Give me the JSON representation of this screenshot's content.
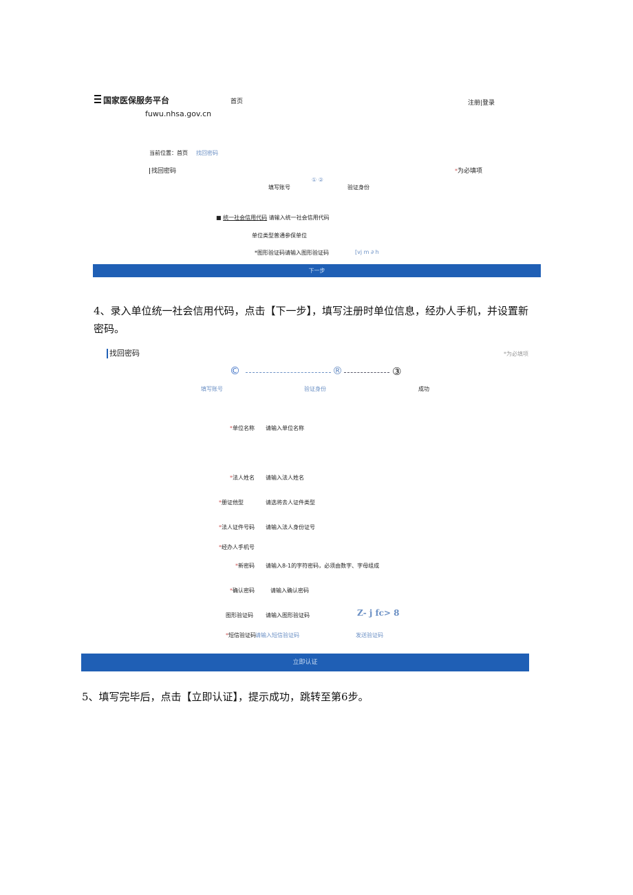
{
  "header": {
    "logo_text": "国家医保服务平台",
    "domain": "fuwu.nhsa.gov.cn",
    "home_link": "首页",
    "auth_links": "注册|登录"
  },
  "breadcrumb": {
    "prefix": "当前位置：首页",
    "current": "找回密码"
  },
  "form1": {
    "section_title": "找回密码",
    "required_note": "为必填项",
    "steps_icons": "① ②",
    "step1_label": "填写账号",
    "step2_label": "验证身份",
    "credit_code_label": "统一社会信用代码",
    "credit_code_placeholder": "请输入统一社会信用代码",
    "unit_type_label": "单位类型",
    "unit_type_value": "普通参保单位",
    "captcha_label": "*图形验证码",
    "captcha_placeholder": "请输入图形验证码",
    "captcha_image_text": "[vj m ∂ h",
    "next_button": "下一步"
  },
  "instruction4": "4、录入单位统一社会信用代码，点击【下一步】，填写注册时单位信息，经办人手机，并设置新密码。",
  "form2": {
    "section_title": "找回密码",
    "required_note": "*为必填项",
    "step_icon_1": "©",
    "step_icon_2": "®",
    "step_icon_3": "③",
    "step1_label": "填写账号",
    "step2_label": "验证身份",
    "step3_label": "成功",
    "fields": [
      {
        "label": "单位名称",
        "placeholder": "请输入单位名称"
      },
      {
        "label": "法人姓名",
        "placeholder": "请输入法人姓名"
      },
      {
        "label": "册证他型",
        "placeholder": "请选将去人证件类型"
      },
      {
        "label": "法人证件号码",
        "placeholder": "请输入法人身份证号"
      },
      {
        "label": "经办人手机号",
        "placeholder": ""
      },
      {
        "label": "新密码",
        "placeholder": "请输入8-1的字符密码，必须由数字、字母组成"
      },
      {
        "label": "确认密码",
        "placeholder": "请输入确认密码"
      },
      {
        "label": "图形验证码",
        "placeholder": "请输入图形验证码"
      },
      {
        "label": "短信验证码",
        "placeholder": "请输入短信验证码"
      }
    ],
    "captcha_image_text": "Z- j fc> 8",
    "send_code": "发送验证码",
    "submit_button": "立即认证"
  },
  "instruction5": "5、填写完毕后，点击【立即认证】，提示成功，跳转至第6步。",
  "colors": {
    "primary": "#1f5fb5",
    "link": "#6a8fc4"
  }
}
